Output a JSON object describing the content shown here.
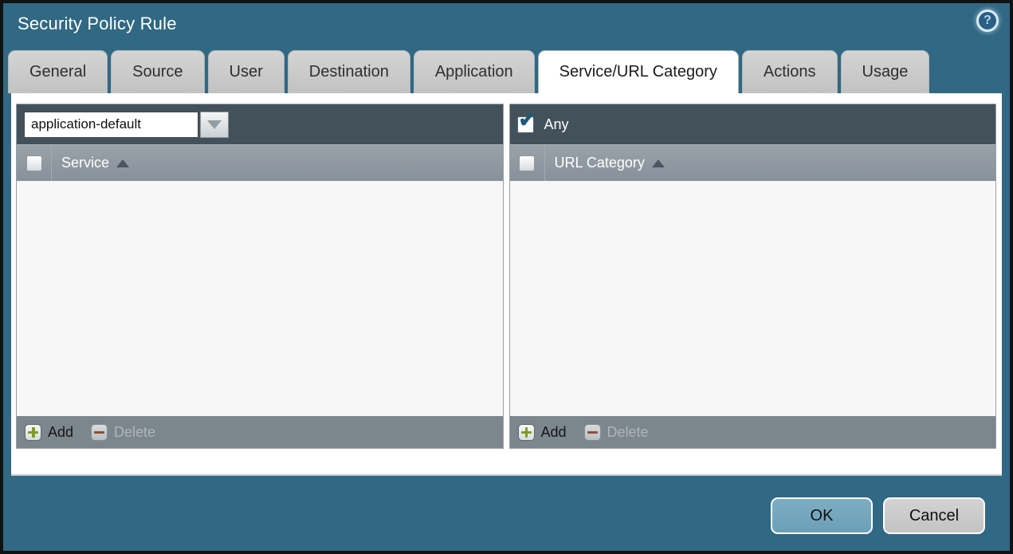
{
  "window": {
    "title": "Security Policy Rule",
    "help_icon": "?"
  },
  "tabs": [
    {
      "label": "General",
      "active": false
    },
    {
      "label": "Source",
      "active": false
    },
    {
      "label": "User",
      "active": false
    },
    {
      "label": "Destination",
      "active": false
    },
    {
      "label": "Application",
      "active": false
    },
    {
      "label": "Service/URL Category",
      "active": true
    },
    {
      "label": "Actions",
      "active": false
    },
    {
      "label": "Usage",
      "active": false
    }
  ],
  "service_panel": {
    "dropdown": {
      "value": "application-default"
    },
    "header": {
      "label": "Service",
      "sort": "ascending",
      "checkbox_checked": false
    },
    "rows": [],
    "footer": {
      "add_label": "Add",
      "delete_label": "Delete",
      "delete_enabled": false
    }
  },
  "url_category_panel": {
    "any": {
      "label": "Any",
      "checked": true,
      "mark": "✔"
    },
    "header": {
      "label": "URL Category",
      "sort": "ascending",
      "checkbox_checked": false
    },
    "rows": [],
    "footer": {
      "add_label": "Add",
      "delete_label": "Delete",
      "delete_enabled": false
    }
  },
  "actions": {
    "ok_label": "OK",
    "cancel_label": "Cancel"
  },
  "colors": {
    "background": "#316883",
    "panel_top_bar": "#43515b",
    "panel_header": "#8b959c",
    "panel_footer": "#7c868d",
    "ok_button": "#74a6bd",
    "cancel_button": "#c9c9c9",
    "add_plus": "#7d9c26",
    "delete_minus": "#8e4f38",
    "checkmark": "#1f5a78",
    "active_tab": "#ffffff"
  }
}
